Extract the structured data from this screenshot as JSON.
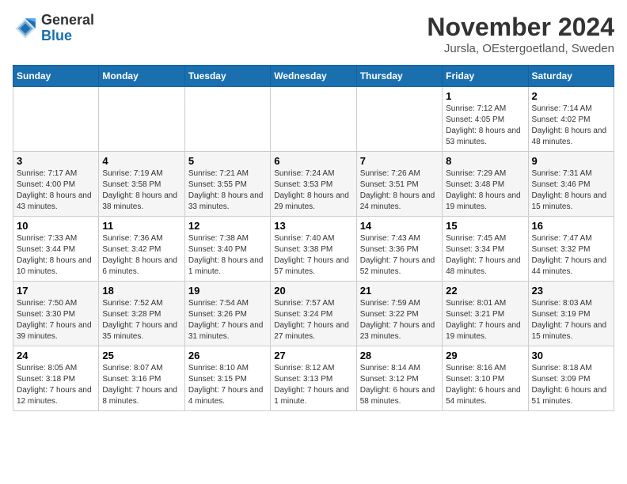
{
  "header": {
    "logo_general": "General",
    "logo_blue": "Blue",
    "month": "November 2024",
    "location": "Jursla, OEstergoetland, Sweden"
  },
  "weekdays": [
    "Sunday",
    "Monday",
    "Tuesday",
    "Wednesday",
    "Thursday",
    "Friday",
    "Saturday"
  ],
  "weeks": [
    [
      {
        "day": "",
        "info": ""
      },
      {
        "day": "",
        "info": ""
      },
      {
        "day": "",
        "info": ""
      },
      {
        "day": "",
        "info": ""
      },
      {
        "day": "",
        "info": ""
      },
      {
        "day": "1",
        "info": "Sunrise: 7:12 AM\nSunset: 4:05 PM\nDaylight: 8 hours and 53 minutes."
      },
      {
        "day": "2",
        "info": "Sunrise: 7:14 AM\nSunset: 4:02 PM\nDaylight: 8 hours and 48 minutes."
      }
    ],
    [
      {
        "day": "3",
        "info": "Sunrise: 7:17 AM\nSunset: 4:00 PM\nDaylight: 8 hours and 43 minutes."
      },
      {
        "day": "4",
        "info": "Sunrise: 7:19 AM\nSunset: 3:58 PM\nDaylight: 8 hours and 38 minutes."
      },
      {
        "day": "5",
        "info": "Sunrise: 7:21 AM\nSunset: 3:55 PM\nDaylight: 8 hours and 33 minutes."
      },
      {
        "day": "6",
        "info": "Sunrise: 7:24 AM\nSunset: 3:53 PM\nDaylight: 8 hours and 29 minutes."
      },
      {
        "day": "7",
        "info": "Sunrise: 7:26 AM\nSunset: 3:51 PM\nDaylight: 8 hours and 24 minutes."
      },
      {
        "day": "8",
        "info": "Sunrise: 7:29 AM\nSunset: 3:48 PM\nDaylight: 8 hours and 19 minutes."
      },
      {
        "day": "9",
        "info": "Sunrise: 7:31 AM\nSunset: 3:46 PM\nDaylight: 8 hours and 15 minutes."
      }
    ],
    [
      {
        "day": "10",
        "info": "Sunrise: 7:33 AM\nSunset: 3:44 PM\nDaylight: 8 hours and 10 minutes."
      },
      {
        "day": "11",
        "info": "Sunrise: 7:36 AM\nSunset: 3:42 PM\nDaylight: 8 hours and 6 minutes."
      },
      {
        "day": "12",
        "info": "Sunrise: 7:38 AM\nSunset: 3:40 PM\nDaylight: 8 hours and 1 minute."
      },
      {
        "day": "13",
        "info": "Sunrise: 7:40 AM\nSunset: 3:38 PM\nDaylight: 7 hours and 57 minutes."
      },
      {
        "day": "14",
        "info": "Sunrise: 7:43 AM\nSunset: 3:36 PM\nDaylight: 7 hours and 52 minutes."
      },
      {
        "day": "15",
        "info": "Sunrise: 7:45 AM\nSunset: 3:34 PM\nDaylight: 7 hours and 48 minutes."
      },
      {
        "day": "16",
        "info": "Sunrise: 7:47 AM\nSunset: 3:32 PM\nDaylight: 7 hours and 44 minutes."
      }
    ],
    [
      {
        "day": "17",
        "info": "Sunrise: 7:50 AM\nSunset: 3:30 PM\nDaylight: 7 hours and 39 minutes."
      },
      {
        "day": "18",
        "info": "Sunrise: 7:52 AM\nSunset: 3:28 PM\nDaylight: 7 hours and 35 minutes."
      },
      {
        "day": "19",
        "info": "Sunrise: 7:54 AM\nSunset: 3:26 PM\nDaylight: 7 hours and 31 minutes."
      },
      {
        "day": "20",
        "info": "Sunrise: 7:57 AM\nSunset: 3:24 PM\nDaylight: 7 hours and 27 minutes."
      },
      {
        "day": "21",
        "info": "Sunrise: 7:59 AM\nSunset: 3:22 PM\nDaylight: 7 hours and 23 minutes."
      },
      {
        "day": "22",
        "info": "Sunrise: 8:01 AM\nSunset: 3:21 PM\nDaylight: 7 hours and 19 minutes."
      },
      {
        "day": "23",
        "info": "Sunrise: 8:03 AM\nSunset: 3:19 PM\nDaylight: 7 hours and 15 minutes."
      }
    ],
    [
      {
        "day": "24",
        "info": "Sunrise: 8:05 AM\nSunset: 3:18 PM\nDaylight: 7 hours and 12 minutes."
      },
      {
        "day": "25",
        "info": "Sunrise: 8:07 AM\nSunset: 3:16 PM\nDaylight: 7 hours and 8 minutes."
      },
      {
        "day": "26",
        "info": "Sunrise: 8:10 AM\nSunset: 3:15 PM\nDaylight: 7 hours and 4 minutes."
      },
      {
        "day": "27",
        "info": "Sunrise: 8:12 AM\nSunset: 3:13 PM\nDaylight: 7 hours and 1 minute."
      },
      {
        "day": "28",
        "info": "Sunrise: 8:14 AM\nSunset: 3:12 PM\nDaylight: 6 hours and 58 minutes."
      },
      {
        "day": "29",
        "info": "Sunrise: 8:16 AM\nSunset: 3:10 PM\nDaylight: 6 hours and 54 minutes."
      },
      {
        "day": "30",
        "info": "Sunrise: 8:18 AM\nSunset: 3:09 PM\nDaylight: 6 hours and 51 minutes."
      }
    ]
  ]
}
